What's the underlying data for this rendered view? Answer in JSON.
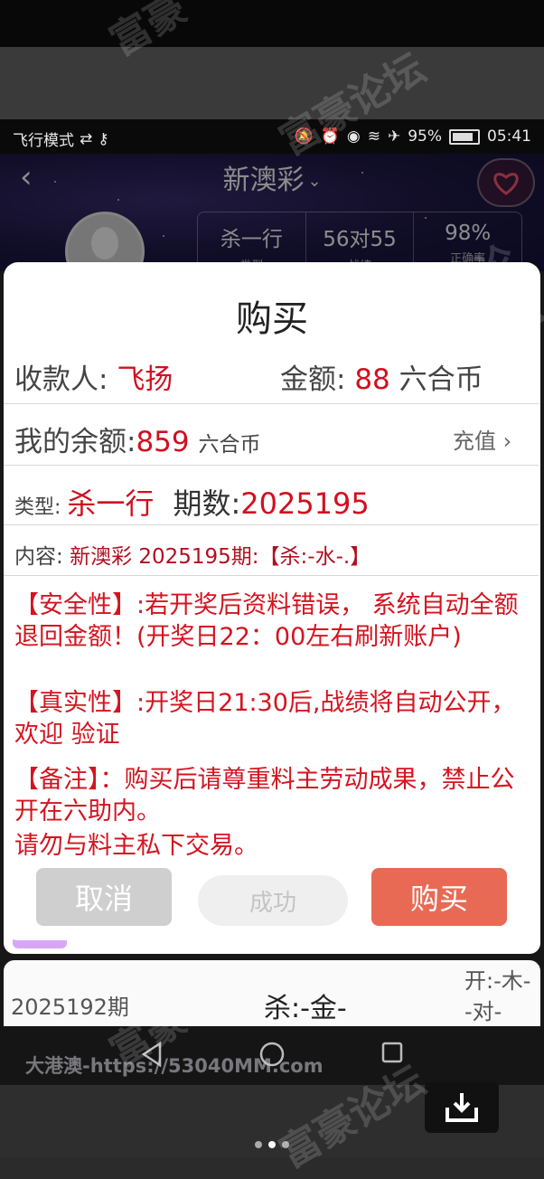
{
  "status_bar": {
    "left_text": "飞行模式",
    "battery": "95%",
    "time": "05:41"
  },
  "header": {
    "title": "新澳彩",
    "chevron": "⌄"
  },
  "stats": [
    {
      "value": "杀一行",
      "label": "类型"
    },
    {
      "value": "56对55",
      "label": "战绩"
    },
    {
      "value": "98%",
      "label": "正确率"
    }
  ],
  "modal": {
    "title": "购买",
    "payee_label": "收款人:",
    "payee_name": "飞扬",
    "amount_label": "金额:",
    "amount_value": "88",
    "amount_unit": "六合币",
    "balance_label": "我的余额:",
    "balance_value": "859",
    "balance_unit": "六合币",
    "recharge_label": "充值",
    "type_label": "类型:",
    "type_value": "杀一行",
    "period_label": "期数:",
    "period_value": "2025195",
    "content_label": "内容:",
    "content_value": "新澳彩 2025195期:【杀:-水-.】",
    "safety": "【安全性】:若开奖后资料错误， 系统自动全额退回金额！(开奖日22：00左右刷新账户)",
    "authenticity": "【真实性】:开奖日21:30后,战绩将自动公开，欢迎 验证",
    "note": "【备注】：购买后请尊重料主劳动成果，禁止公开在六助内。",
    "warning": "请勿与料主私下交易。",
    "cancel_label": "取消",
    "success_label": "成功",
    "buy_label": "购买"
  },
  "background_card": {
    "period": "2025192期",
    "pick": "杀:-金-",
    "open_line1": "开:-木-",
    "open_line2": "-对-"
  },
  "watermark": "大港澳-https://53040MM.com",
  "watermark_site": "富豪论坛",
  "colors": {
    "accent_red": "#d01020",
    "buy_button": "#e86a55",
    "header_bg": "#1e1846"
  }
}
